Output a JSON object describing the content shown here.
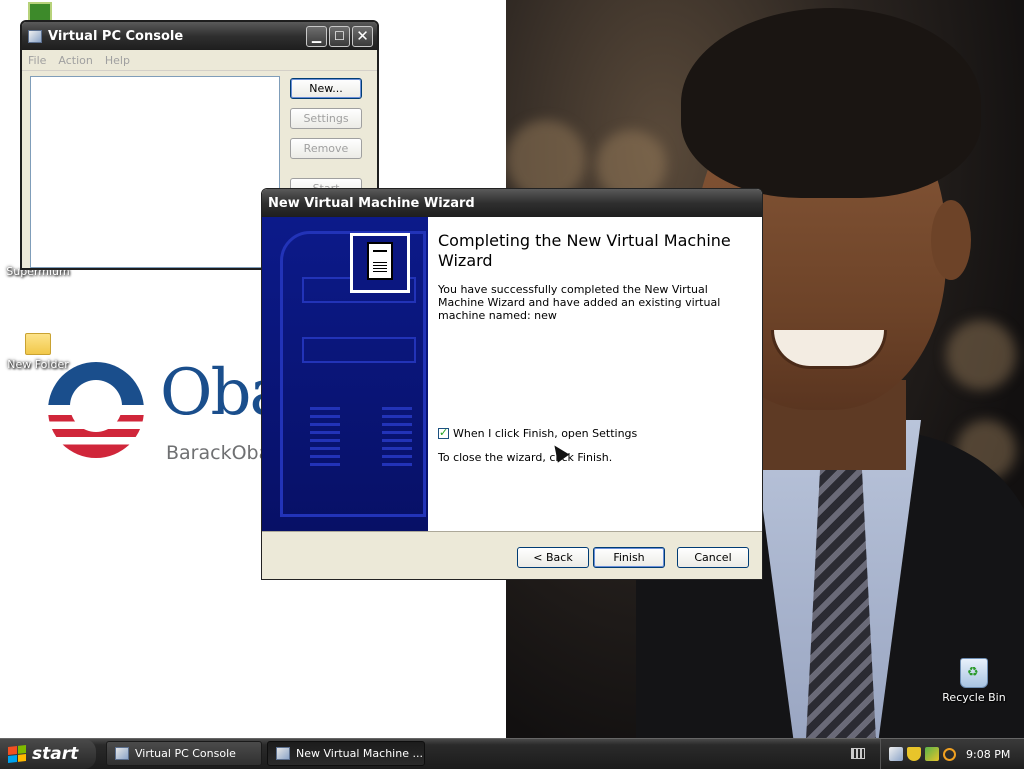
{
  "desktop": {
    "icons": [
      {
        "label": "Supermium"
      },
      {
        "label": "New Folder"
      },
      {
        "label": "Recycle Bin"
      }
    ],
    "logo": {
      "word": "Oba",
      "sub": "BarackOba"
    }
  },
  "console": {
    "title": "Virtual PC Console",
    "menu": [
      "File",
      "Action",
      "Help"
    ],
    "buttons": {
      "new": "New...",
      "settings": "Settings",
      "remove": "Remove",
      "start": "Start"
    }
  },
  "wizard": {
    "title": "New Virtual Machine Wizard",
    "heading": "Completing the New Virtual Machine Wizard",
    "body": "You have successfully completed the New Virtual Machine Wizard and have added an existing virtual machine named: new",
    "checkbox_label": "When I click Finish, open Settings",
    "checkbox_checked": true,
    "hint": "To close the wizard, click Finish.",
    "buttons": {
      "back": "< Back",
      "finish": "Finish",
      "cancel": "Cancel"
    }
  },
  "taskbar": {
    "start_label": "start",
    "tasks": [
      {
        "label": "Virtual PC Console"
      },
      {
        "label": "New Virtual Machine ..."
      }
    ],
    "clock": "9:08 PM"
  },
  "colors": {
    "wizard_sidebar": "#0c1a8a",
    "window_chrome": "#2f2f2f",
    "dialog_face": "#ece9d8"
  }
}
